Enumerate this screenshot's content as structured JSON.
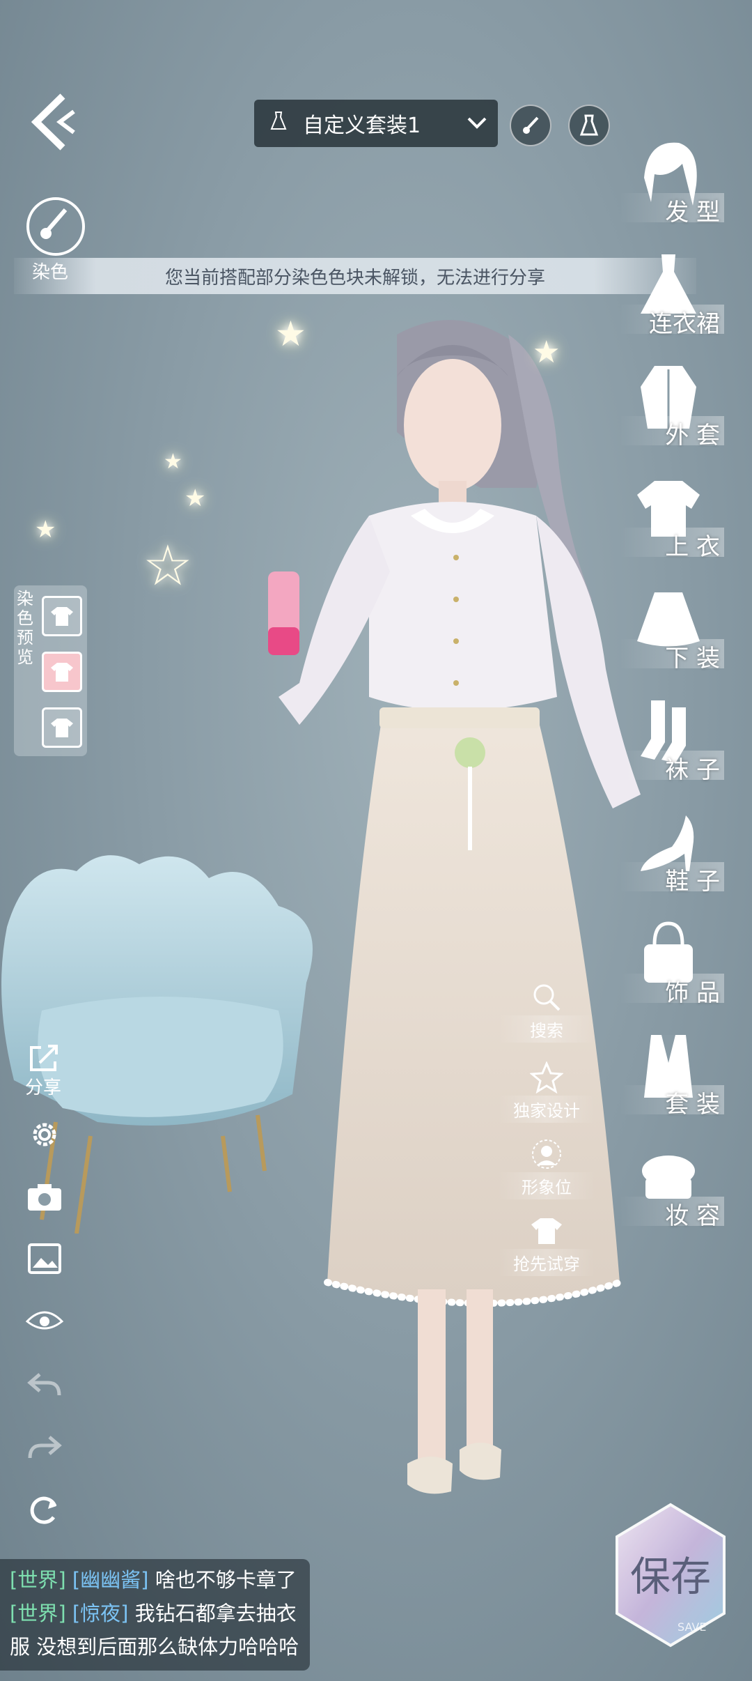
{
  "header": {
    "outfit_name": "自定义套装1",
    "back_icon": "back-arrow-icon",
    "dye_toggle_icon": "brush-icon",
    "dress_toggle_icon": "dress-icon"
  },
  "dye": {
    "label": "染色",
    "notice": "您当前搭配部分染色色块未解锁，无法进行分享"
  },
  "dye_preview": {
    "label": "染色预览",
    "swatches": [
      "#ffffff",
      "#f7c6cc",
      "#ffffff"
    ]
  },
  "categories": [
    {
      "label": "发 型",
      "icon": "hair-icon"
    },
    {
      "label": "连衣裙",
      "icon": "dress-icon"
    },
    {
      "label": "外 套",
      "icon": "coat-icon"
    },
    {
      "label": "上 衣",
      "icon": "shirt-icon"
    },
    {
      "label": "下 装",
      "icon": "skirt-icon"
    },
    {
      "label": "袜 子",
      "icon": "socks-icon"
    },
    {
      "label": "鞋 子",
      "icon": "heel-shoe-icon"
    },
    {
      "label": "饰 品",
      "icon": "bag-icon"
    },
    {
      "label": "套 装",
      "icon": "suit-icon"
    },
    {
      "label": "妆 容",
      "icon": "makeup-icon"
    }
  ],
  "actions": [
    {
      "label": "搜索",
      "icon": "search-icon"
    },
    {
      "label": "独家设计",
      "icon": "star-icon"
    },
    {
      "label": "形象位",
      "icon": "portrait-icon"
    },
    {
      "label": "抢先试穿",
      "icon": "tshirt-icon"
    }
  ],
  "tools": {
    "share_label": "分享"
  },
  "chat": {
    "messages": [
      {
        "channel": "[世界]",
        "name": "[幽幽酱]",
        "text": "啥也不够卡章了"
      },
      {
        "channel": "[世界]",
        "name": "[惊夜]",
        "text": "我钻石都拿去抽衣"
      },
      {
        "channel": "",
        "name": "",
        "text": "服 没想到后面那么缺体力哈哈哈"
      }
    ]
  },
  "save": {
    "label": "保存",
    "sub": "SAVE"
  },
  "colors": {
    "background": "#8a9ca6",
    "chat_channel": "#7ee0b0",
    "chat_name": "#7cc4f5"
  }
}
